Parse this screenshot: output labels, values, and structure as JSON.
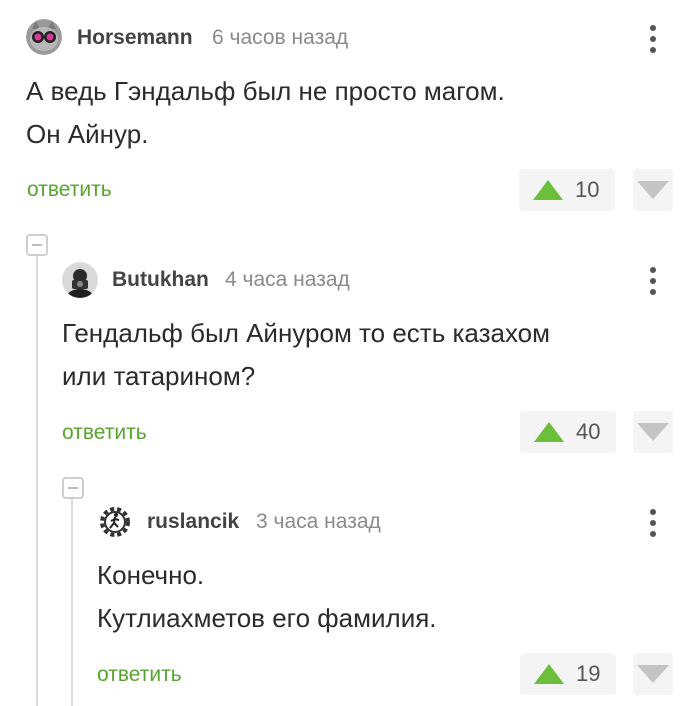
{
  "comments": [
    {
      "author": "Horsemann",
      "time": "6 часов назад",
      "text_lines": [
        "А ведь Гэндальф был не просто магом.",
        "Он Айнур."
      ],
      "reply_label": "ответить",
      "score": "10",
      "avatar_icon": "cat-with-goggles-avatar"
    },
    {
      "author": "Butukhan",
      "time": "4 часа назад",
      "text_lines": [
        "Гендальф был Айнуром то есть казахом",
        "или татарином?"
      ],
      "reply_label": "ответить",
      "score": "40",
      "avatar_icon": "photographer-avatar"
    },
    {
      "author": "ruslancik",
      "time": "3 часа назад",
      "text_lines": [
        "Конечно.",
        "Кутлиахметов его фамилия."
      ],
      "reply_label": "ответить",
      "score": "19",
      "avatar_icon": "gear-runner-avatar"
    }
  ],
  "colors": {
    "accent_green": "#57a52e",
    "upvote_green": "#6cbf3b",
    "downvote_gray": "#c4c4c4"
  }
}
